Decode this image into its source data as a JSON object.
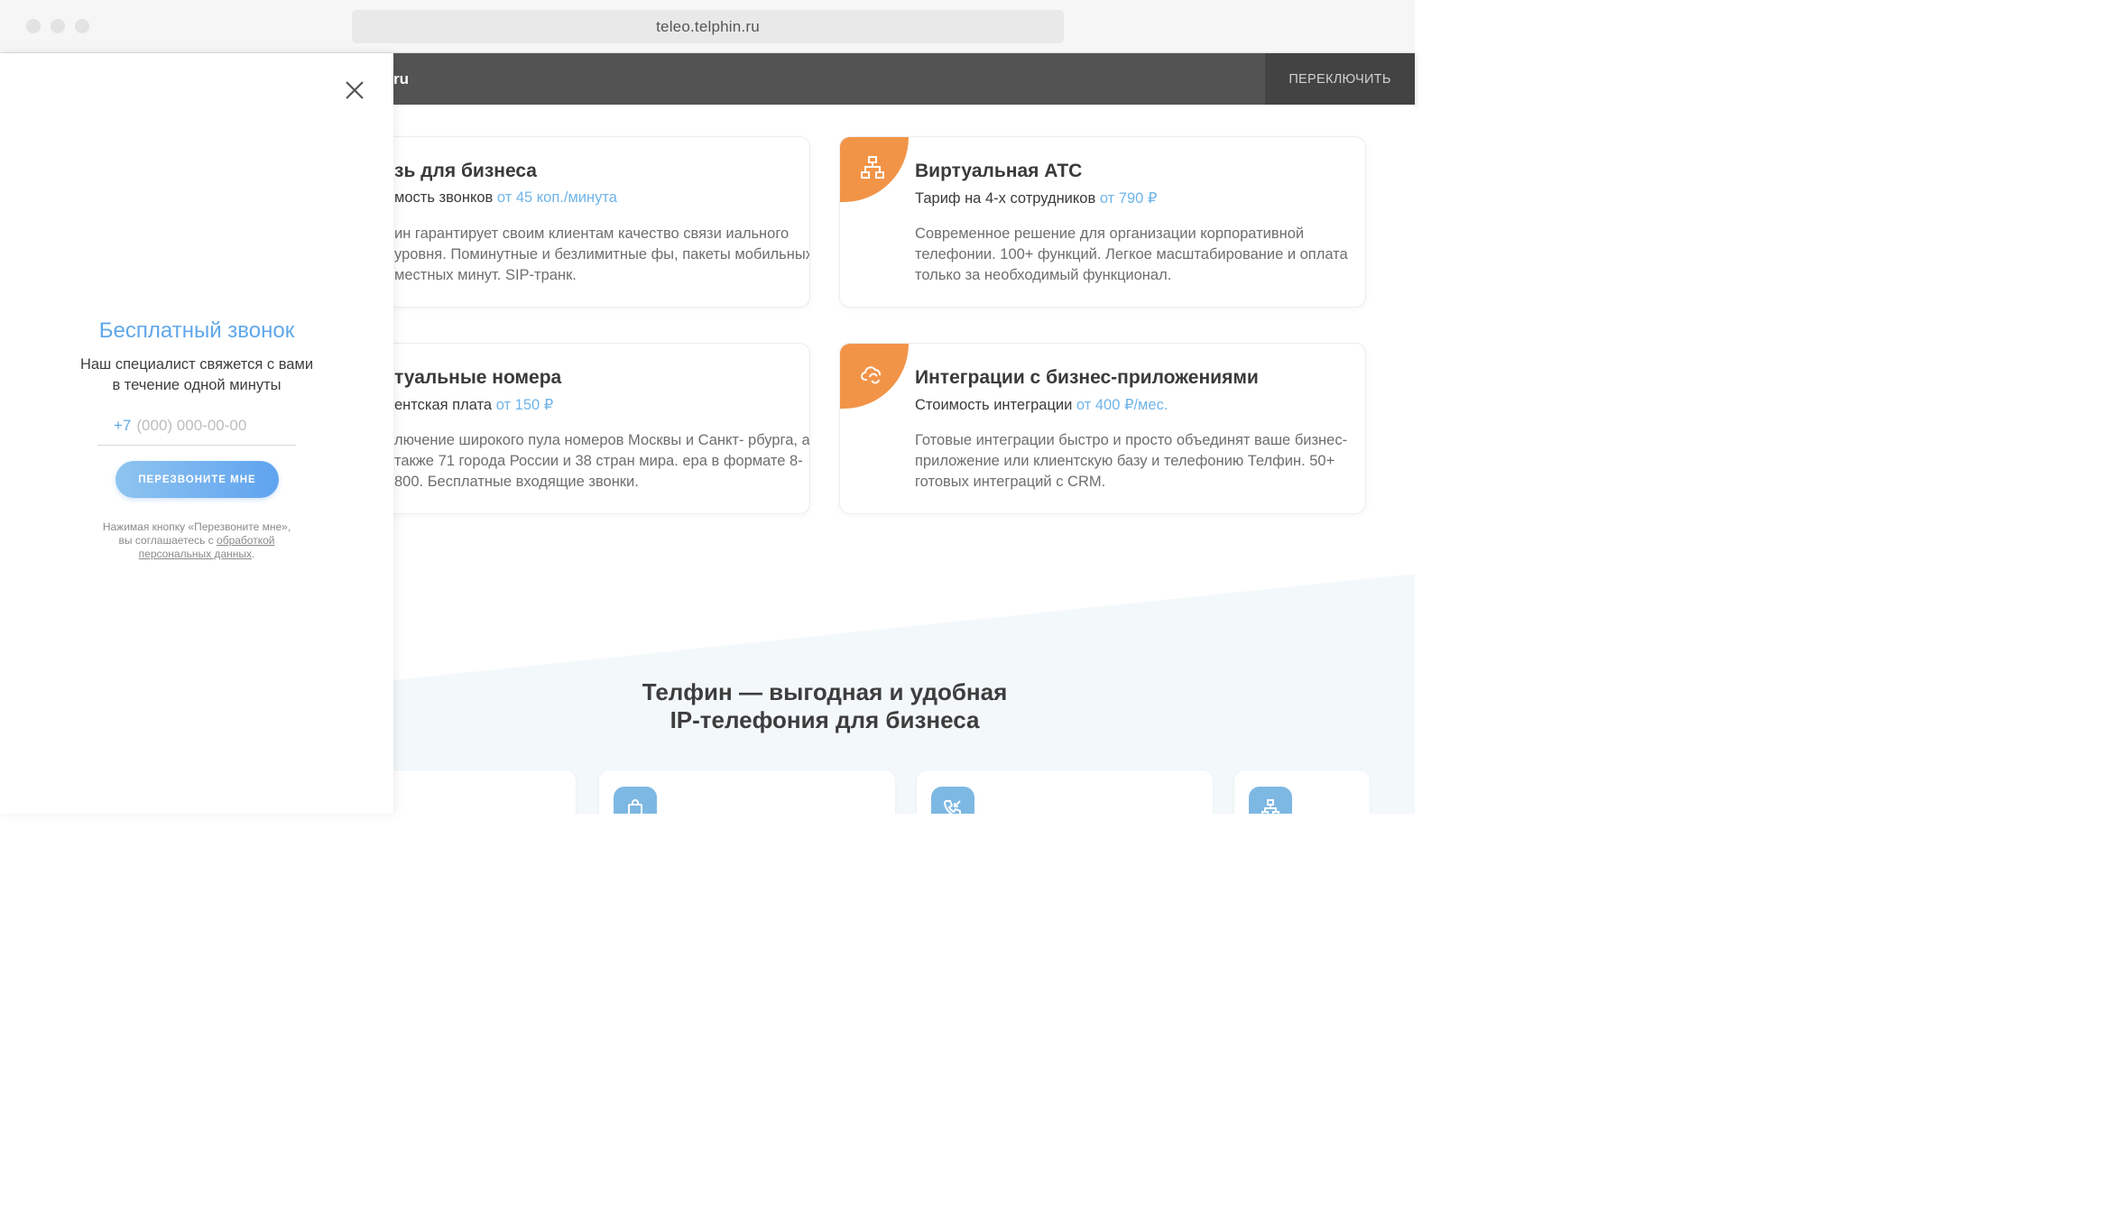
{
  "browser": {
    "url": "teleo.telphin.ru"
  },
  "topbar": {
    "site_fragment": "ru",
    "switch_label": "ПЕРЕКЛЮЧИТЬ"
  },
  "cards": [
    {
      "title": "зь для бизнеса",
      "sub_prefix": "мость звонков ",
      "price": "от 45 коп./минута",
      "desc": "ин гарантирует своим клиентам качество связи иального уровня. Поминутные и безлимитные фы, пакеты мобильных и местных минут. SIP-транк."
    },
    {
      "title": "Виртуальная АТС",
      "sub_prefix": "Тариф на 4-х сотрудников ",
      "price": "от 790 ₽",
      "desc": "Современное решение для организации корпоративной телефонии. 100+ функций. Легкое масштабирование и оплата только за необходимый функционал.",
      "icon": "network-icon"
    },
    {
      "title": "туальные номера",
      "sub_prefix": "ентская плата ",
      "price": "от 150 ₽",
      "desc": "лючение широкого пула номеров Москвы и Санкт- рбурга, а также 71 города России и 38 стран мира. ера в формате 8-800. Бесплатные входящие звонки."
    },
    {
      "title": "Интеграции с бизнес-приложениями",
      "sub_prefix": "Стоимость интеграции ",
      "price": "от 400 ₽/мес.",
      "desc": "Готовые интеграции быстро и просто объединят ваше бизнес-приложение или клиентскую базу и телефонию Телфин. 50+ готовых интеграций с CRM.",
      "icon": "cloud-sync-icon"
    }
  ],
  "section": {
    "heading_line1": "Телфин — выгодная и удобная",
    "heading_line2": "IP-телефония для бизнеса"
  },
  "panel": {
    "title": "Бесплатный звонок",
    "sub_line1": "Наш специалист свяжется с вами",
    "sub_line2": "в течение одной минуты",
    "phone_prefix": "+7",
    "phone_placeholder": "(000) 000-00-00",
    "button_label": "ПЕРЕЗВОНИТЕ МНЕ",
    "legal_line1": "Нажимая кнопку «Перезвоните мне»,",
    "legal_line2_prefix": "вы соглашаетесь с ",
    "legal_link1": "обработкой",
    "legal_link2": "персональных данных",
    "legal_suffix": "."
  },
  "colors": {
    "accent_orange": "#f29448",
    "accent_blue": "#5fa7ea",
    "price_blue": "#6fb4e8",
    "topbar": "#535353"
  }
}
